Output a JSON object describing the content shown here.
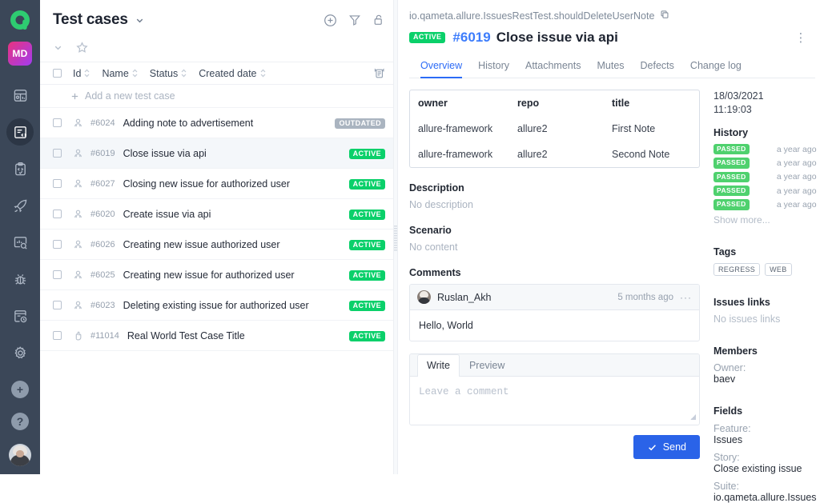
{
  "rail": {
    "logo": "allure-logo",
    "project_badge": "MD",
    "items": [
      {
        "name": "dashboards-icon",
        "active": false
      },
      {
        "name": "test-cases-icon",
        "active": true
      },
      {
        "name": "test-plans-icon",
        "active": false
      },
      {
        "name": "launches-icon",
        "active": false
      },
      {
        "name": "analytics-icon",
        "active": false
      },
      {
        "name": "defects-icon",
        "active": false
      },
      {
        "name": "timeline-icon",
        "active": false
      },
      {
        "name": "settings-icon",
        "active": false
      }
    ],
    "add_label": "+",
    "help_label": "?"
  },
  "list_panel": {
    "title": "Test cases",
    "title_caret": "chevron-down-icon",
    "actions": [
      "add-icon",
      "filter-icon",
      "lock-icon"
    ],
    "sub_actions": [
      "collapse-icon",
      "star-icon"
    ],
    "columns": [
      "Id",
      "Name",
      "Status",
      "Created date"
    ],
    "add_row_label": "Add a new test case",
    "rows": [
      {
        "id": "#6024",
        "name": "Adding note to advertisement",
        "status": "OUTDATED",
        "status_kind": "outdated",
        "selected": false,
        "type_icon": "user-icon"
      },
      {
        "id": "#6019",
        "name": "Close issue via api",
        "status": "ACTIVE",
        "status_kind": "active",
        "selected": true,
        "type_icon": "user-icon"
      },
      {
        "id": "#6027",
        "name": "Closing new issue for authorized user",
        "status": "ACTIVE",
        "status_kind": "active",
        "selected": false,
        "type_icon": "user-icon"
      },
      {
        "id": "#6020",
        "name": "Create issue via api",
        "status": "ACTIVE",
        "status_kind": "active",
        "selected": false,
        "type_icon": "user-icon"
      },
      {
        "id": "#6026",
        "name": "Creating new issue authorized user",
        "status": "ACTIVE",
        "status_kind": "active",
        "selected": false,
        "type_icon": "user-icon"
      },
      {
        "id": "#6025",
        "name": "Creating new issue for authorized user",
        "status": "ACTIVE",
        "status_kind": "active",
        "selected": false,
        "type_icon": "user-icon"
      },
      {
        "id": "#6023",
        "name": "Deleting existing issue for authorized user",
        "status": "ACTIVE",
        "status_kind": "active",
        "selected": false,
        "type_icon": "user-icon"
      },
      {
        "id": "#11014",
        "name": "Real World Test Case Title",
        "status": "ACTIVE",
        "status_kind": "active",
        "selected": false,
        "type_icon": "manual-icon"
      }
    ]
  },
  "detail": {
    "breadcrumb": "io.qameta.allure.IssuesRestTest.shouldDeleteUserNote",
    "copy_icon": "copy-icon",
    "status_badge": "ACTIVE",
    "id": "#6019",
    "title": "Close issue via api",
    "kebab_icon": "more-vertical-icon",
    "tabs": [
      {
        "label": "Overview",
        "active": true
      },
      {
        "label": "History",
        "active": false
      },
      {
        "label": "Attachments",
        "active": false
      },
      {
        "label": "Mutes",
        "active": false
      },
      {
        "label": "Defects",
        "active": false
      },
      {
        "label": "Change log",
        "active": false
      }
    ],
    "overview_table": {
      "headers": [
        "owner",
        "repo",
        "title"
      ],
      "rows": [
        [
          "allure-framework",
          "allure2",
          "First Note"
        ],
        [
          "allure-framework",
          "allure2",
          "Second Note"
        ]
      ]
    },
    "description_heading": "Description",
    "description_value": "No description",
    "scenario_heading": "Scenario",
    "scenario_value": "No content",
    "comments_heading": "Comments",
    "comment": {
      "author": "Ruslan_Akh",
      "time": "5 months ago",
      "text": "Hello, World",
      "menu_icon": "ellipsis-icon",
      "avatar": "user-avatar"
    },
    "editor": {
      "tabs": [
        {
          "label": "Write",
          "active": true
        },
        {
          "label": "Preview",
          "active": false
        }
      ],
      "placeholder": "Leave a comment",
      "value": ""
    },
    "send_label": "Send",
    "send_icon": "check-icon"
  },
  "side": {
    "date": "18/03/2021",
    "time": "11:19:03",
    "history_heading": "History",
    "history": [
      {
        "status": "PASSED",
        "ago": "a year ago"
      },
      {
        "status": "PASSED",
        "ago": "a year ago"
      },
      {
        "status": "PASSED",
        "ago": "a year ago"
      },
      {
        "status": "PASSED",
        "ago": "a year ago"
      },
      {
        "status": "PASSED",
        "ago": "a year ago"
      }
    ],
    "show_more": "Show more...",
    "tags_heading": "Tags",
    "tags": [
      "REGRESS",
      "WEB"
    ],
    "issues_heading": "Issues links",
    "issues_value": "No issues links",
    "members_heading": "Members",
    "owner_key": "Owner:",
    "owner_value": "baev",
    "fields_heading": "Fields",
    "fields": [
      {
        "key": "Feature:",
        "value": "Issues"
      },
      {
        "key": "Story:",
        "value": "Close existing issue"
      },
      {
        "key": "Suite:",
        "value": "io.qameta.allure.Issues"
      }
    ]
  },
  "colors": {
    "rail_bg": "#3b4758",
    "accent_blue": "#2c6bf6",
    "send_blue": "#2a63e8",
    "status_active": "#0ad06a",
    "status_outdated": "#aab4c0",
    "status_passed": "#4fd16e"
  }
}
